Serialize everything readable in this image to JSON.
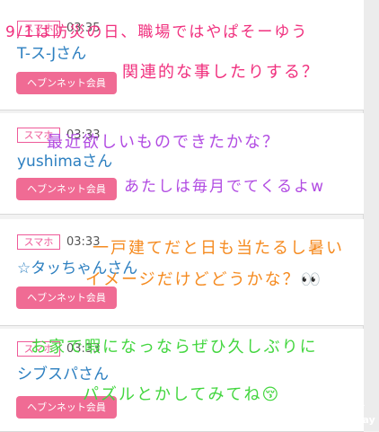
{
  "posts": [
    {
      "badge": "スマホ",
      "time": "03:35",
      "name": "T-ス-Jさん",
      "member_button": "ヘブンネット会員"
    },
    {
      "badge": "スマホ",
      "time": "03:33",
      "name": "yushimaさん",
      "member_button": "ヘブンネット会員"
    },
    {
      "badge": "スマホ",
      "time": "03:33",
      "name": "☆タッちゃんさん",
      "member_button": "ヘブンネット会員"
    },
    {
      "badge": "スマホ",
      "time": "03:33",
      "name": "シブスパさん",
      "member_button": "ヘブンネット会員"
    }
  ],
  "overlay": {
    "line1": "9/1は防災の日、職場ではやぱそーゆう",
    "line2": "関連的な事したりする？",
    "line3": "最近欲しいものできたかな？",
    "line4": "あたしは毎月でてくるよw",
    "line5": "一戸建てだと日も当たるし暑い",
    "line6": "イメージだけどどうかな？👀",
    "line7": "お家で暇になっならぜひ久しぶりに",
    "line8": "パズルとかしてみてね😚"
  },
  "watermark": "PingPlay"
}
